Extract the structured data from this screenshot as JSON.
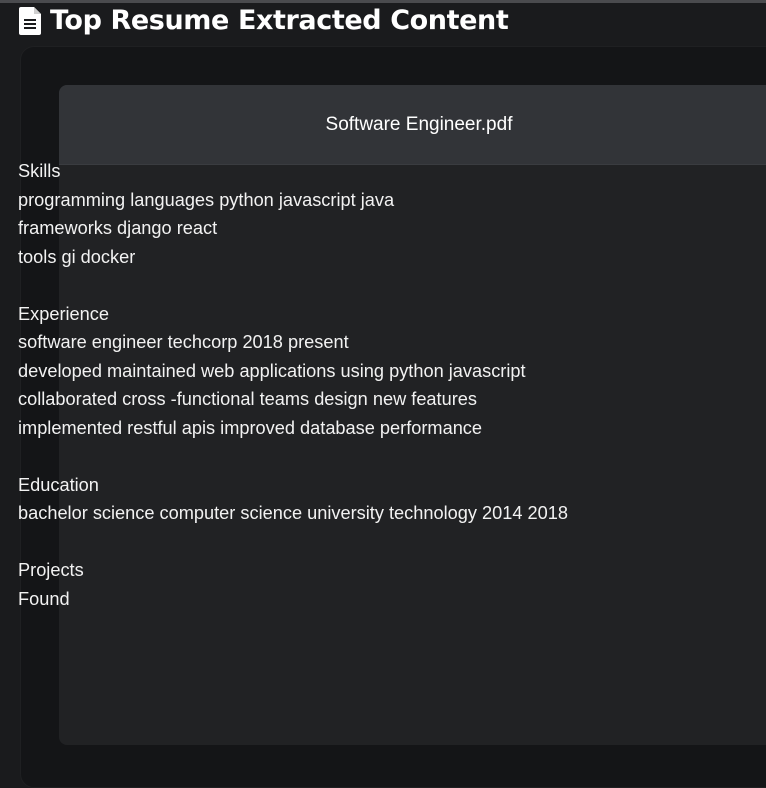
{
  "page": {
    "title": "Top Resume Extracted Content",
    "icon": "document-icon"
  },
  "card": {
    "filename": "Software Engineer.pdf",
    "content": [
      "Skills",
      "programming languages python javascript java",
      "frameworks django react",
      "tools gi docker",
      "",
      "Experience",
      "software engineer techcorp 2018 present",
      "developed maintained web applications using python javascript",
      "collaborated cross -functional teams design new features",
      "implemented restful apis improved database performance",
      "",
      "Education",
      "bachelor science computer science university technology 2014 2018",
      "",
      "Projects",
      "Found"
    ]
  },
  "colors": {
    "background": "#1a1b1d",
    "card_header": "#323438",
    "card_body": "#212224",
    "text": "#ffffff"
  }
}
